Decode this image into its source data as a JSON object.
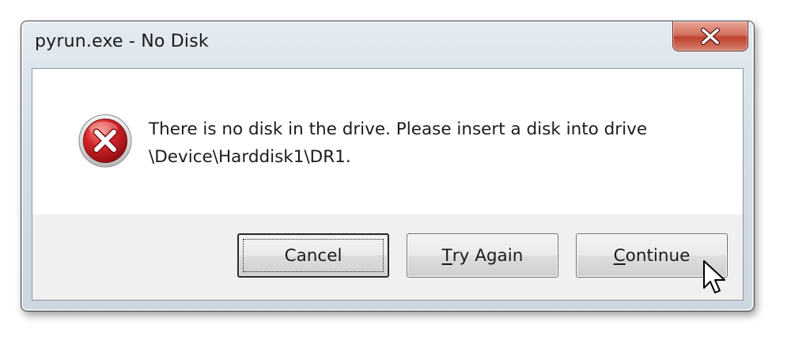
{
  "window": {
    "title": "pyrun.exe - No Disk"
  },
  "titlebar": {
    "close_icon": "close-x-icon"
  },
  "message": {
    "line1": "There is no disk in the drive. Please insert a disk into drive",
    "line2": "\\Device\\Harddisk1\\DR1.",
    "icon": "error-icon"
  },
  "buttons": {
    "cancel": {
      "label": "Cancel"
    },
    "try_again": {
      "mnemonic": "T",
      "rest": "ry Again"
    },
    "continue": {
      "mnemonic": "C",
      "rest": "ontinue"
    }
  },
  "colors": {
    "error_red": "#c8161d",
    "close_red": "#c0432f",
    "frame": "#d5dee6",
    "button_area": "#f0f0f0"
  }
}
